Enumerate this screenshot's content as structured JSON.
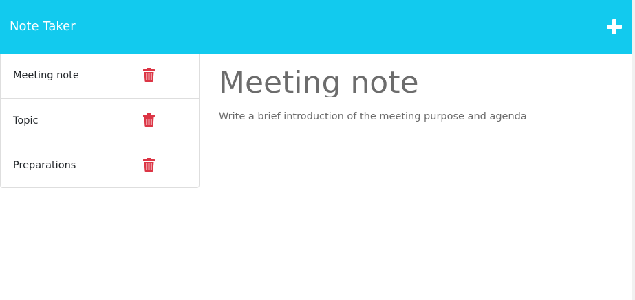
{
  "header": {
    "title": "Note Taker",
    "new_note_icon": "plus-icon",
    "background": "#12caee"
  },
  "sidebar": {
    "notes": [
      {
        "title": "Meeting note",
        "delete_icon": "trash-icon"
      },
      {
        "title": "Topic",
        "delete_icon": "trash-icon"
      },
      {
        "title": "Preparations",
        "delete_icon": "trash-icon"
      }
    ],
    "delete_color": "#dc3545"
  },
  "editor": {
    "title": "Meeting note",
    "text": "Write a brief introduction of the meeting purpose and agenda"
  }
}
